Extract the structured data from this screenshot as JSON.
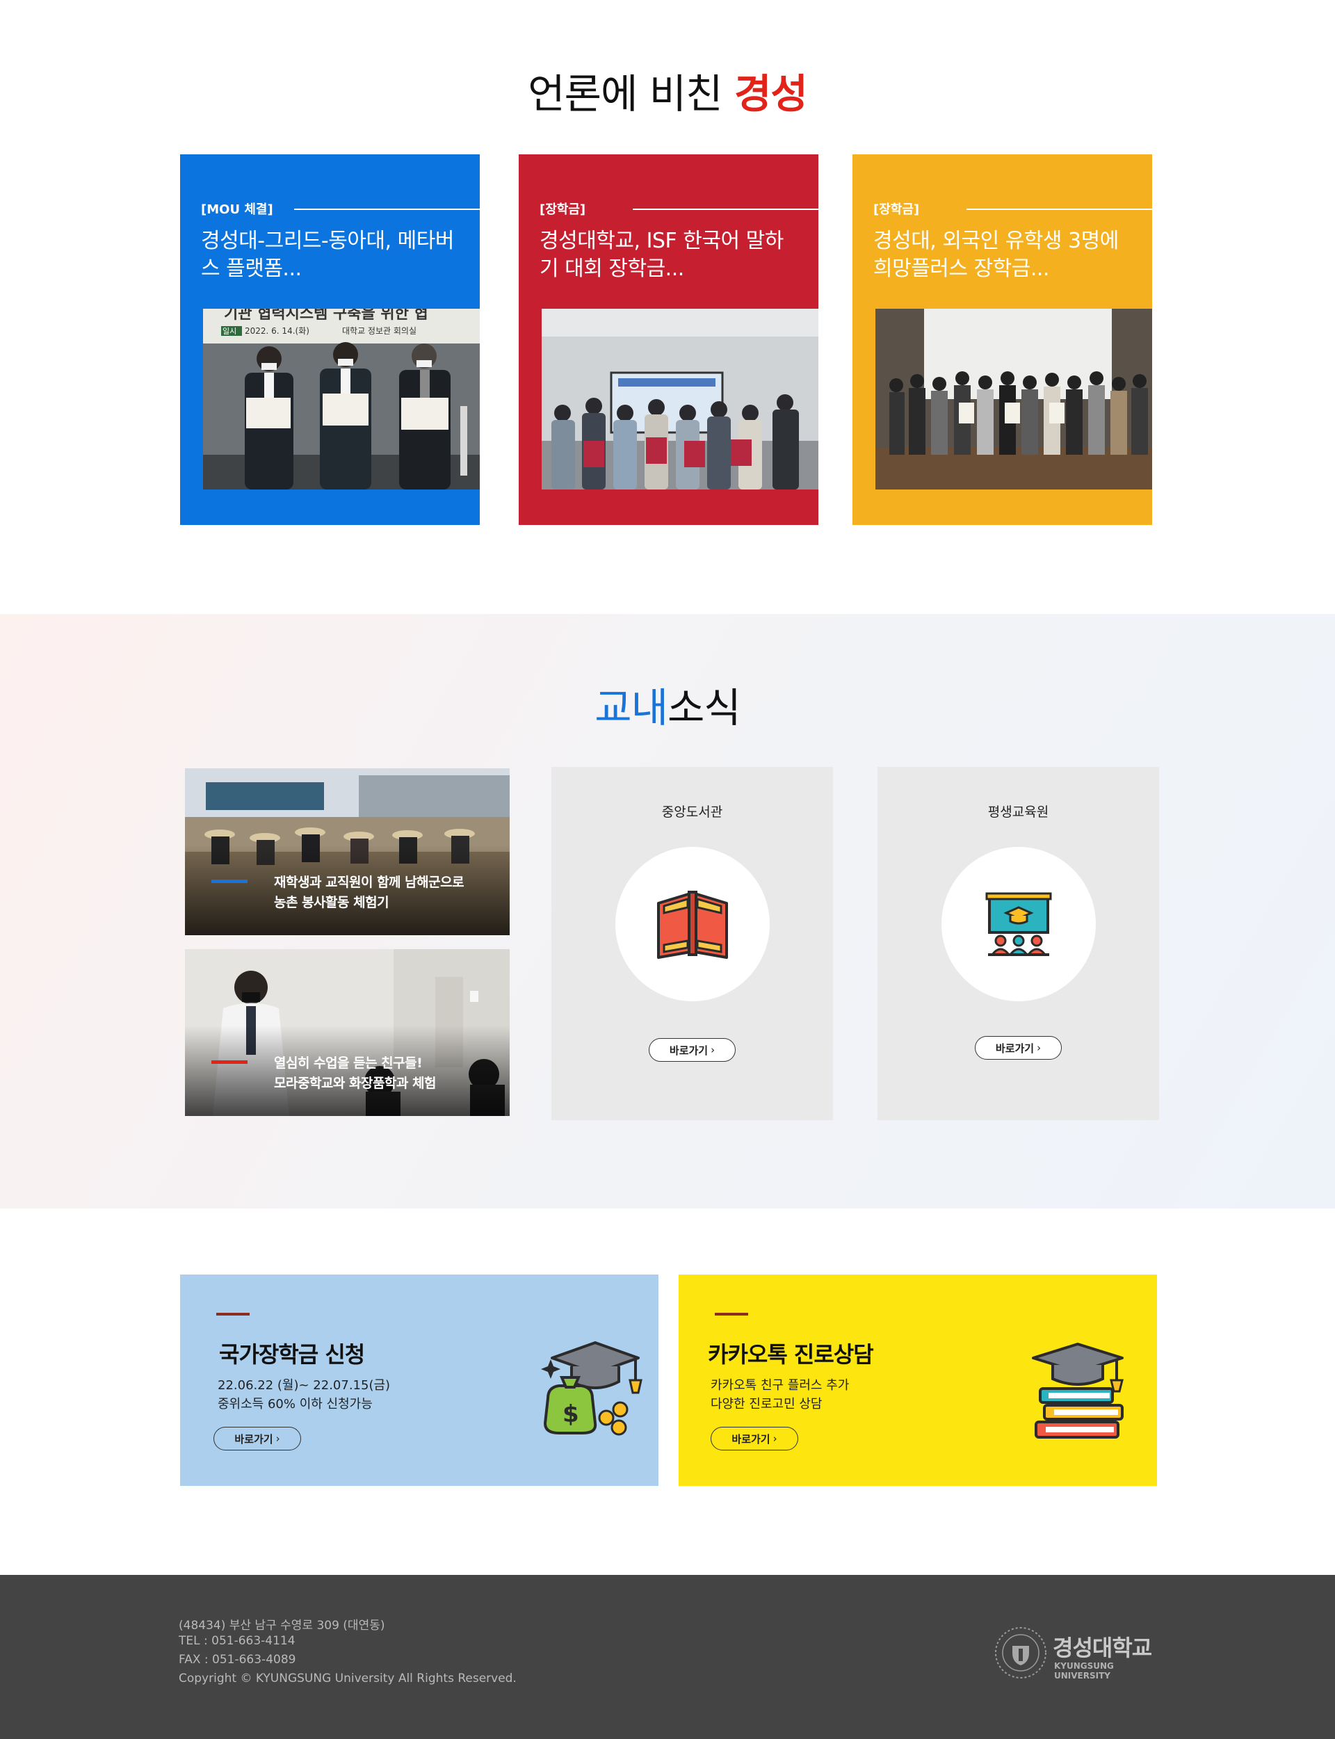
{
  "press": {
    "title_prefix": "언론에 비친 ",
    "title_accent": "경성",
    "cards": [
      {
        "tag": "[MOU 체결]",
        "title": "경성대-그리드-동아대, 메타버스 플랫폼...",
        "color": "#0b74de",
        "photo_caption_1": "기관 협력시스템 구축을 위한 협",
        "photo_caption_2": "2022. 6. 14.(화)",
        "photo_caption_3": "대학교 정보관 회의실",
        "photo_caption_tag": "일시"
      },
      {
        "tag": "[장학금]",
        "title": "경성대학교, ISF 한국어 말하기 대회 장학금...",
        "color": "#c61f30"
      },
      {
        "tag": "[장학금]",
        "title": "경성대, 외국인 유학생 3명에 희망플러스 장학금...",
        "color": "#f5b01f"
      }
    ]
  },
  "campus": {
    "title_accent": "교내",
    "title_rest": "소식",
    "news": [
      {
        "line1": "재학생과 교직원이 함께 남해군으로",
        "line2": "농촌 봉사활동 체험기"
      },
      {
        "line1": "열심히 수업을 듣는 친구들!",
        "line2": "모라중학교와 화장품학과 체험"
      }
    ],
    "boxes": [
      {
        "title": "중앙도서관",
        "button": "바로가기",
        "icon": "book-icon"
      },
      {
        "title": "평생교육원",
        "button": "바로가기",
        "icon": "lecture-icon"
      }
    ]
  },
  "banners": [
    {
      "title": "국가장학금 신청",
      "line1": "22.06.22 (월)~ 22.07.15(금)",
      "line2": "중위소득 60% 이하 신청가능",
      "button": "바로가기",
      "icon": "scholarship-money-icon",
      "color": "#abcfed"
    },
    {
      "title": "카카오톡 진로상담",
      "line1": "카카오톡 친구 플러스 추가",
      "line2": "다양한 진로고민 상담",
      "button": "바로가기",
      "icon": "graduation-books-icon",
      "color": "#fde50f"
    }
  ],
  "footer": {
    "address": "(48434) 부산 남구 수영로 309 (대연동)",
    "tel": "TEL : 051-663-4114",
    "fax": "FAX : 051-663-4089",
    "copyright": "Copyright © KYUNGSUNG University All Rights Reserved.",
    "logo_name": "경성대학교",
    "logo_english": "KYUNGSUNG UNIVERSITY"
  }
}
